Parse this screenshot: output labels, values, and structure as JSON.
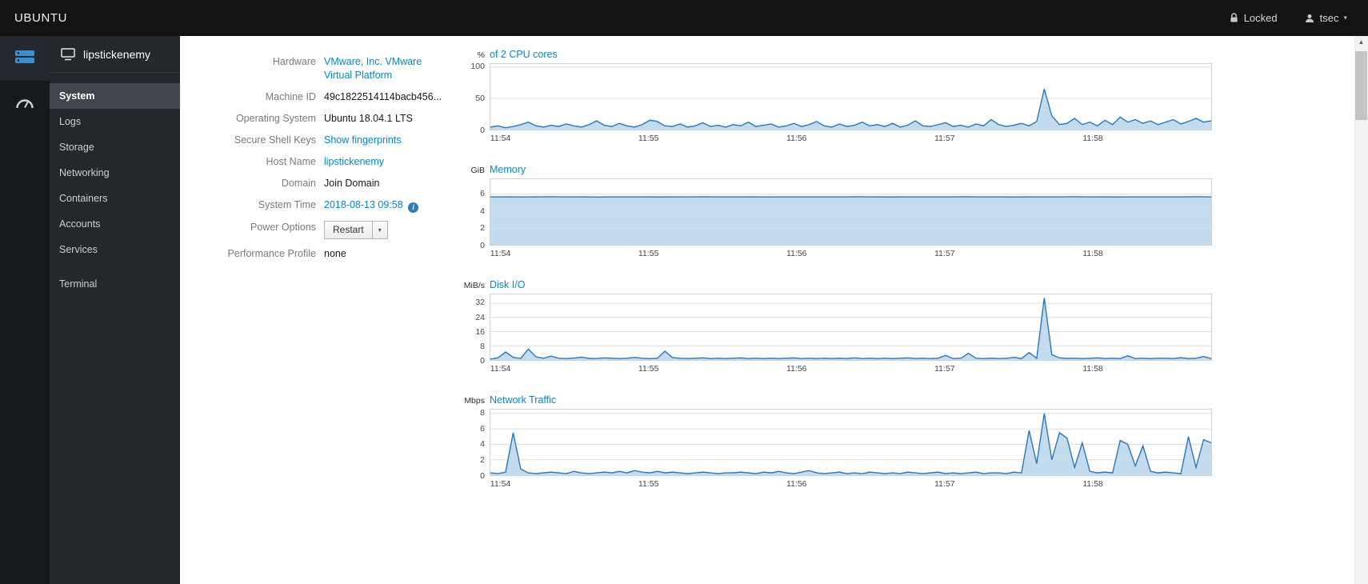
{
  "theme": {
    "accent": "#0088ce",
    "topbar_bg": "#131313",
    "sidebar_bg": "#24272b",
    "iconstrip_bg": "#171a1d",
    "active_item_bg": "#41464c",
    "chart_line": "#2b77b8",
    "chart_fill": "#c3dbee",
    "chart_grid": "#dcdcdc"
  },
  "topbar": {
    "brand": "UBUNTU",
    "locked_label": "Locked",
    "user_label": "tsec"
  },
  "sidebar": {
    "host": "lipstickenemy",
    "items": [
      {
        "id": "system",
        "label": "System",
        "active": true
      },
      {
        "id": "logs",
        "label": "Logs"
      },
      {
        "id": "storage",
        "label": "Storage"
      },
      {
        "id": "networking",
        "label": "Networking"
      },
      {
        "id": "containers",
        "label": "Containers"
      },
      {
        "id": "accounts",
        "label": "Accounts"
      },
      {
        "id": "services",
        "label": "Services"
      },
      {
        "id": "terminal",
        "label": "Terminal",
        "gap": true
      }
    ]
  },
  "info": {
    "rows": [
      {
        "label": "Hardware",
        "value": "VMware, Inc. VMware Virtual Platform",
        "type": "link"
      },
      {
        "label": "Machine ID",
        "value": "49c1822514114bacb456...",
        "type": "text"
      },
      {
        "label": "Operating System",
        "value": "Ubuntu 18.04.1 LTS",
        "type": "text"
      },
      {
        "label": "Secure Shell Keys",
        "value": "Show fingerprints",
        "type": "link"
      },
      {
        "label": "Host Name",
        "value": "lipstickenemy",
        "type": "link"
      },
      {
        "label": "Domain",
        "value": "Join Domain",
        "type": "text"
      },
      {
        "label": "System Time",
        "value": "2018-08-13 09:58",
        "type": "link-info"
      },
      {
        "label": "Power Options",
        "value": "Restart",
        "type": "split-button"
      },
      {
        "label": "Performance Profile",
        "value": "none",
        "type": "text"
      }
    ]
  },
  "chart_data": [
    {
      "id": "cpu",
      "type": "area",
      "unit": "%",
      "title": "of 2 CPU cores",
      "ylim": [
        0,
        105
      ],
      "yticks": [
        0,
        50,
        100
      ],
      "xticks": [
        "11:54",
        "11:55",
        "11:56",
        "11:57",
        "11:58"
      ],
      "values": [
        4,
        6,
        3,
        5,
        8,
        12,
        6,
        4,
        7,
        5,
        9,
        6,
        4,
        8,
        14,
        7,
        5,
        10,
        6,
        4,
        8,
        15,
        13,
        6,
        5,
        9,
        4,
        6,
        11,
        5,
        7,
        4,
        8,
        6,
        12,
        5,
        7,
        9,
        4,
        6,
        10,
        5,
        8,
        13,
        6,
        4,
        9,
        5,
        7,
        12,
        6,
        8,
        5,
        10,
        4,
        7,
        14,
        6,
        5,
        8,
        11,
        5,
        7,
        4,
        9,
        6,
        16,
        8,
        5,
        7,
        10,
        6,
        13,
        65,
        22,
        8,
        10,
        18,
        8,
        12,
        6,
        15,
        8,
        20,
        12,
        16,
        10,
        14,
        8,
        12,
        16,
        9,
        13,
        18,
        12,
        14
      ]
    },
    {
      "id": "memory",
      "type": "area",
      "unit": "GiB",
      "title": "Memory",
      "ylim": [
        0,
        7.8
      ],
      "yticks": [
        0,
        2,
        4,
        6
      ],
      "xticks": [
        "11:54",
        "11:55",
        "11:56",
        "11:57",
        "11:58"
      ],
      "values": [
        5.7,
        5.7,
        5.69,
        5.7,
        5.71,
        5.7,
        5.7,
        5.68,
        5.7,
        5.7,
        5.7,
        5.69,
        5.7,
        5.7,
        5.71,
        5.7,
        5.7,
        5.7,
        5.69,
        5.7,
        5.7,
        5.7,
        5.7,
        5.7,
        5.71,
        5.7,
        5.69,
        5.7,
        5.7,
        5.7,
        5.7,
        5.71,
        5.7,
        5.7,
        5.69,
        5.7,
        5.7,
        5.7,
        5.71,
        5.7,
        5.7,
        5.69,
        5.7,
        5.7,
        5.7,
        5.7,
        5.71,
        5.7
      ]
    },
    {
      "id": "disk-io",
      "type": "area",
      "unit": "MiB/s",
      "title": "Disk I/O",
      "ylim": [
        0,
        37
      ],
      "yticks": [
        0,
        8,
        16,
        24,
        32
      ],
      "xticks": [
        "11:54",
        "11:55",
        "11:56",
        "11:57",
        "11:58"
      ],
      "values": [
        0.6,
        1.2,
        4.5,
        1.5,
        0.9,
        6.2,
        1.8,
        1.0,
        2.2,
        1.0,
        0.8,
        1.1,
        1.6,
        0.9,
        0.8,
        1.2,
        1.0,
        0.8,
        1.0,
        1.5,
        1.0,
        0.8,
        1.0,
        5.0,
        1.4,
        1.0,
        0.8,
        1.0,
        1.2,
        0.8,
        1.0,
        0.8,
        1.0,
        1.2,
        0.8,
        1.0,
        0.8,
        1.0,
        0.8,
        1.0,
        1.2,
        0.8,
        1.0,
        0.8,
        1.0,
        0.8,
        1.0,
        0.8,
        1.2,
        0.8,
        1.0,
        0.8,
        1.0,
        0.8,
        1.0,
        1.2,
        0.8,
        1.0,
        0.8,
        1.0,
        2.6,
        0.8,
        1.0,
        3.8,
        1.0,
        0.8,
        1.0,
        0.8,
        1.0,
        1.5,
        0.8,
        4.2,
        1.0,
        35,
        3.0,
        1.2,
        0.9,
        1.0,
        0.8,
        1.0,
        1.2,
        0.8,
        1.0,
        0.8,
        2.4,
        0.8,
        1.0,
        0.8,
        1.0,
        1.0,
        0.8,
        1.3,
        0.8,
        1.0,
        2.0,
        0.8
      ]
    },
    {
      "id": "network-traffic",
      "type": "area",
      "unit": "Mbps",
      "title": "Network Traffic",
      "ylim": [
        0,
        8.5
      ],
      "yticks": [
        0,
        2,
        4,
        6,
        8
      ],
      "xticks": [
        "11:54",
        "11:55",
        "11:56",
        "11:57",
        "11:58"
      ],
      "values": [
        0.3,
        0.2,
        0.4,
        5.5,
        0.8,
        0.3,
        0.2,
        0.3,
        0.4,
        0.3,
        0.2,
        0.5,
        0.3,
        0.2,
        0.3,
        0.4,
        0.3,
        0.5,
        0.3,
        0.6,
        0.4,
        0.3,
        0.5,
        0.3,
        0.4,
        0.3,
        0.2,
        0.3,
        0.4,
        0.3,
        0.2,
        0.3,
        0.3,
        0.4,
        0.3,
        0.2,
        0.4,
        0.3,
        0.5,
        0.3,
        0.2,
        0.4,
        0.6,
        0.3,
        0.2,
        0.3,
        0.4,
        0.2,
        0.3,
        0.2,
        0.4,
        0.3,
        0.2,
        0.3,
        0.2,
        0.4,
        0.3,
        0.2,
        0.3,
        0.4,
        0.2,
        0.3,
        0.2,
        0.3,
        0.4,
        0.2,
        0.3,
        0.3,
        0.2,
        0.4,
        0.3,
        5.8,
        1.5,
        8.0,
        2.0,
        5.5,
        4.8,
        1.0,
        4.2,
        0.5,
        0.3,
        0.4,
        0.3,
        4.5,
        4.0,
        1.2,
        3.8,
        0.5,
        0.3,
        0.4,
        0.3,
        0.2,
        5.0,
        1.0,
        4.6,
        4.2
      ]
    }
  ]
}
